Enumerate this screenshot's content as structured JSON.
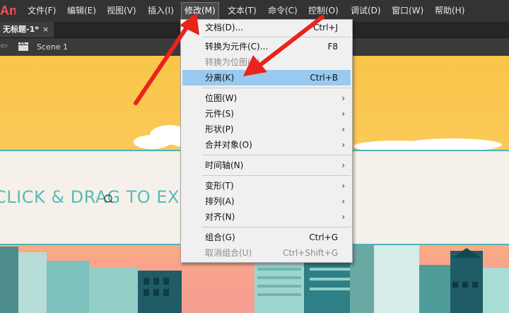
{
  "app": {
    "logo": "An",
    "logo_color": "#ff4f4f"
  },
  "menubar": {
    "items": [
      {
        "label": "文件(F)"
      },
      {
        "label": "编辑(E)"
      },
      {
        "label": "视图(V)"
      },
      {
        "label": "插入(I)"
      },
      {
        "label": "修改(M)"
      },
      {
        "label": "文本(T)"
      },
      {
        "label": "命令(C)"
      },
      {
        "label": "控制(O)"
      },
      {
        "label": "调试(D)"
      },
      {
        "label": "窗口(W)"
      },
      {
        "label": "帮助(H)"
      }
    ],
    "active_item": "修改(M)"
  },
  "document_tab": {
    "title": "无标题-1*",
    "close": "×"
  },
  "scene": {
    "label": "Scene 1"
  },
  "stage": {
    "banner_text": "CLICK & DRAG TO EXP"
  },
  "modify_menu": {
    "items": [
      {
        "label": "文档(D)...",
        "shortcut": "Ctrl+J"
      },
      {
        "label": "转换为元件(C)...",
        "shortcut": "F8"
      },
      {
        "label": "转换为位图(B)",
        "shortcut": ""
      },
      {
        "label": "分离(K)",
        "shortcut": "Ctrl+B"
      },
      {
        "label": "位图(W)",
        "arrow": "›"
      },
      {
        "label": "元件(S)",
        "arrow": "›"
      },
      {
        "label": "形状(P)",
        "arrow": "›"
      },
      {
        "label": "合并对象(O)",
        "arrow": "›"
      },
      {
        "label": "时间轴(N)",
        "arrow": "›"
      },
      {
        "label": "变形(T)",
        "arrow": "›"
      },
      {
        "label": "排列(A)",
        "arrow": "›"
      },
      {
        "label": "对齐(N)",
        "arrow": "›"
      },
      {
        "label": "组合(G)",
        "shortcut": "Ctrl+G"
      },
      {
        "label": "取消组合(U)",
        "shortcut": "Ctrl+Shift+G"
      }
    ],
    "highlight_color": "#99c9ef"
  },
  "annotation_color": "#e8241c"
}
